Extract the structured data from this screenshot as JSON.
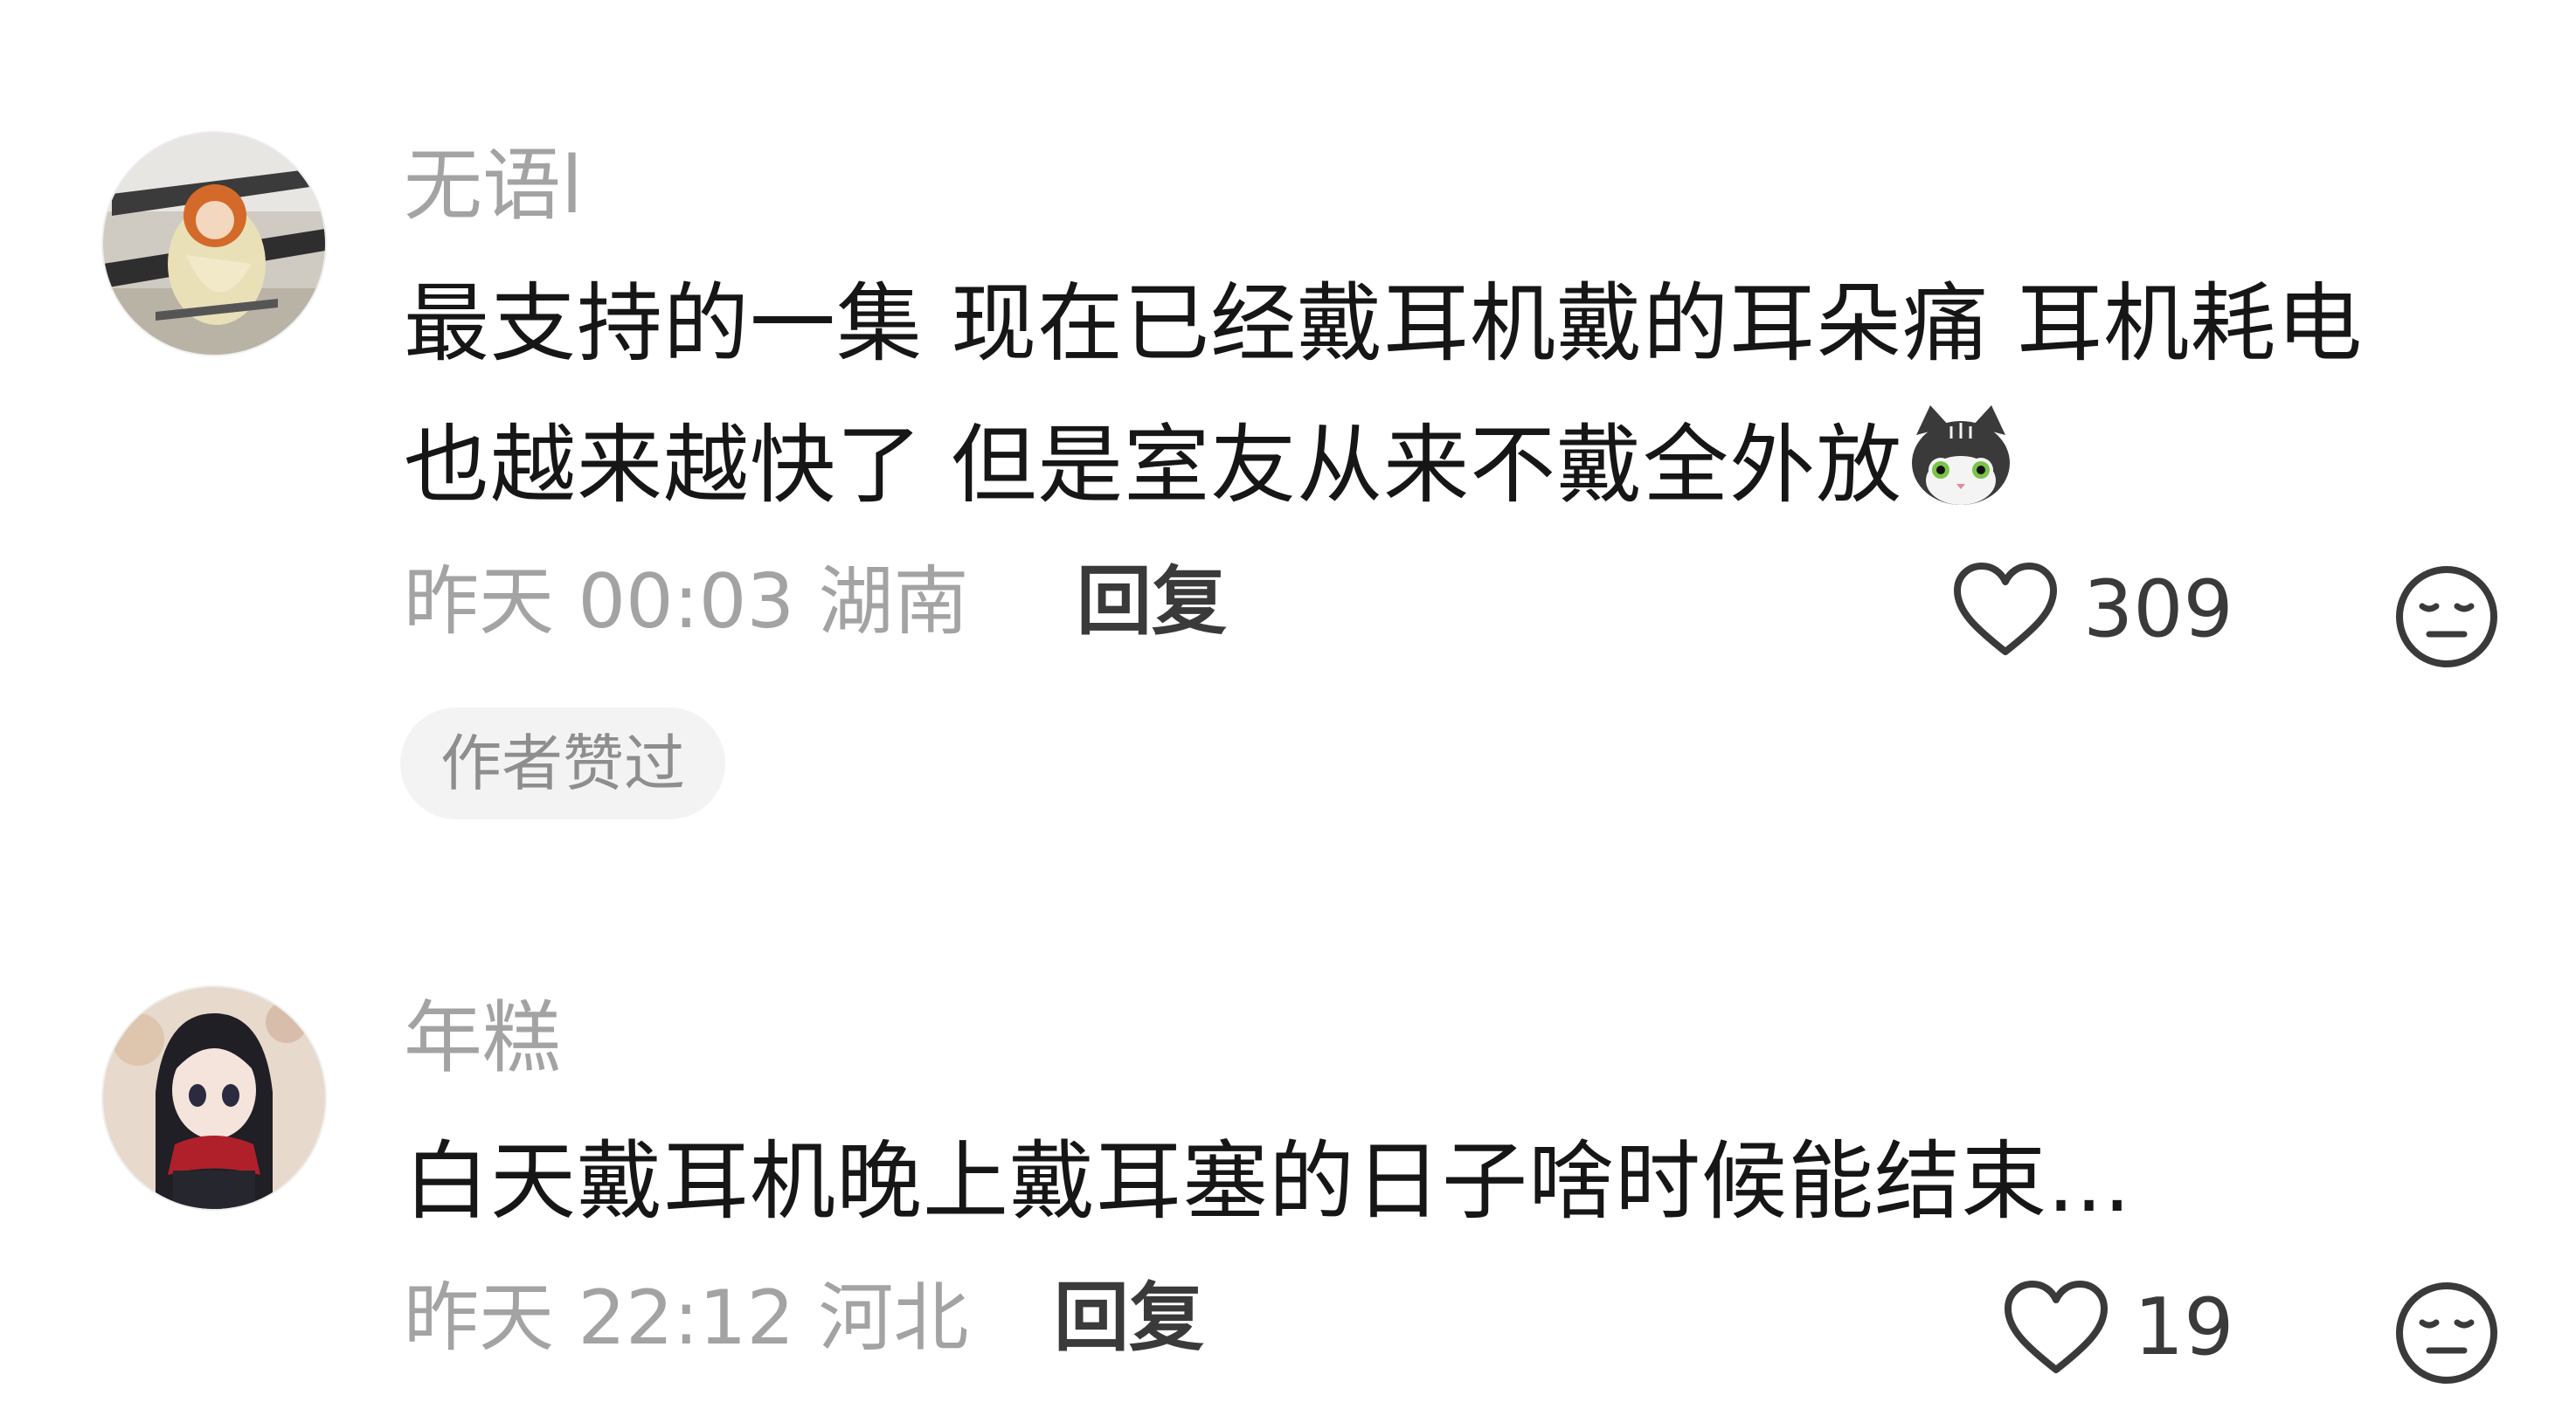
{
  "comments": [
    {
      "username": "无语l",
      "text_line1": "最支持的一集 现在已经戴耳机戴的耳朵痛 耳机耗电",
      "text_line2": "也越来越快了 但是室友从来不戴全外放",
      "emoji": "cat-face-emoji",
      "time": "昨天 00:03",
      "location": "湖南",
      "reply_label": "回复",
      "likes": "309",
      "badge": "作者赞过"
    },
    {
      "username": "年糕",
      "text_line1": "白天戴耳机晚上戴耳塞的日子啥时候能结束...",
      "time": "昨天 22:12",
      "location": "河北",
      "reply_label": "回复",
      "likes": "19"
    }
  ],
  "icons": {
    "like": "heart-outline-icon",
    "dislike": "neutral-face-icon"
  },
  "colors": {
    "text_primary": "#161616",
    "text_secondary": "#a3a3a3",
    "badge_bg": "#f3f3f3"
  }
}
